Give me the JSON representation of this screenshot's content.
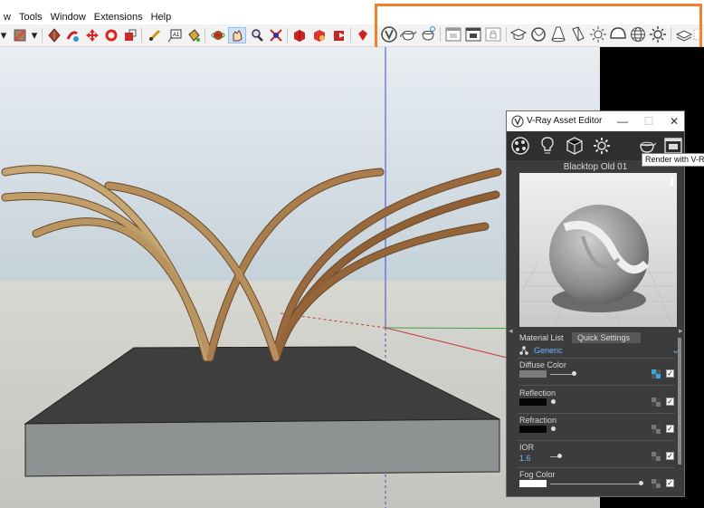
{
  "menu": {
    "items": [
      "w",
      "Tools",
      "Window",
      "Extensions",
      "Help"
    ]
  },
  "vray_toolbar": {
    "highlight_color": "#f2812e",
    "icons": [
      "vray-logo-icon",
      "render-teapot-icon",
      "interactive-render-icon",
      "frame-buffer-icon",
      "render-region-icon",
      "lock-icon",
      "cap-icon",
      "sphere-light-icon",
      "spot-light-icon",
      "ies-light-icon",
      "omni-light-icon",
      "dome-light-icon",
      "globe-icon",
      "sun-light-icon",
      "proxy-icon",
      "mesh-icon"
    ]
  },
  "asset_editor": {
    "title": "V-Ray Asset Editor",
    "window_controls": {
      "minimize": "—",
      "maximize": "☐",
      "close": "✕"
    },
    "material_name": "Blacktop Old 01",
    "lower_tabs": [
      "Material List",
      "Quick Settings"
    ],
    "dropdown_value": "Generic",
    "params": [
      {
        "label": "Diffuse Color",
        "swatch": "#7c7c7c",
        "value": "",
        "level": 0.22,
        "checked": "✓"
      },
      {
        "label": "Reflection",
        "swatch": "#050505",
        "value": "",
        "level": 0.02,
        "checked": "✓"
      },
      {
        "label": "Refraction",
        "swatch": "#050505",
        "value": "",
        "level": 0.02,
        "checked": "✓"
      },
      {
        "label": "IOR",
        "swatch": "",
        "value": "1.6",
        "level": 0.06,
        "checked": "✓"
      },
      {
        "label": "Fog Color",
        "swatch": "#ffffff",
        "value": "",
        "level": 0.9,
        "checked": "✓"
      }
    ]
  },
  "tooltip": "Render with V-Ray"
}
